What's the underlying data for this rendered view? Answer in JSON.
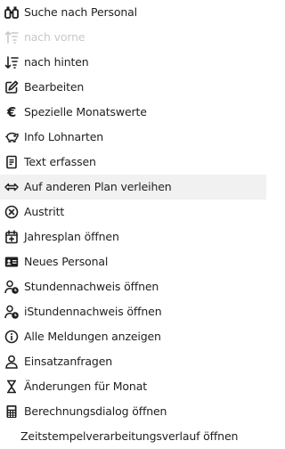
{
  "menu": {
    "items": [
      {
        "label": "Suche nach Personal",
        "icon": "binoculars-icon"
      },
      {
        "label": "nach vorne",
        "icon": "sort-up-icon",
        "disabled": true
      },
      {
        "label": "nach hinten",
        "icon": "sort-down-icon"
      },
      {
        "label": "Bearbeiten",
        "icon": "edit-icon"
      },
      {
        "label": "Spezielle Monatswerte",
        "icon": "euro-icon"
      },
      {
        "label": "Info Lohnarten",
        "icon": "piggy-bank-icon"
      },
      {
        "label": "Text erfassen",
        "icon": "document-text-icon"
      },
      {
        "label": "Auf anderen Plan verleihen",
        "icon": "left-right-arrow-icon",
        "highlight": true
      },
      {
        "label": "Austritt",
        "icon": "cancel-circle-icon"
      },
      {
        "label": "Jahresplan öffnen",
        "icon": "calendar-plus-icon"
      },
      {
        "label": "Neues Personal",
        "icon": "id-card-icon"
      },
      {
        "label": "Stundennachweis öffnen",
        "icon": "user-clock-icon"
      },
      {
        "label": "iStundennachweis öffnen",
        "icon": "user-clock-icon"
      },
      {
        "label": "Alle Meldungen anzeigen",
        "icon": "info-circle-icon"
      },
      {
        "label": "Einsatzanfragen",
        "icon": "user-outline-icon"
      },
      {
        "label": "Änderungen für Monat",
        "icon": "hourglass-icon"
      },
      {
        "label": "Berechnungsdialog öffnen",
        "icon": "calculator-icon"
      },
      {
        "label": "Zeitstempelverarbeitungsverlauf öffnen",
        "icon": ""
      }
    ]
  }
}
